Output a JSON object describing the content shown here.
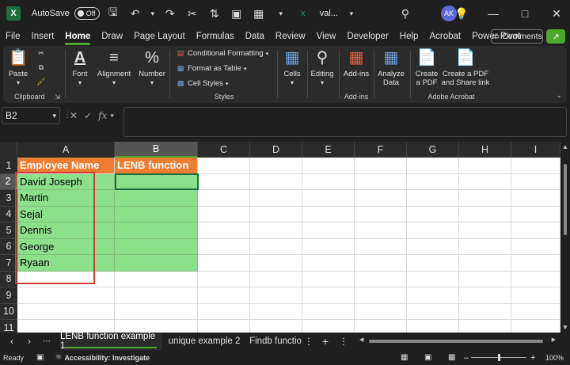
{
  "titlebar": {
    "app_icon": "X",
    "autosave_label": "AutoSave",
    "autosave_state": "Off",
    "filename": "val...",
    "avatar_initials": "AK"
  },
  "ribbon_tabs": [
    "File",
    "Insert",
    "Home",
    "Draw",
    "Page Layout",
    "Formulas",
    "Data",
    "Review",
    "View",
    "Developer",
    "Help",
    "Acrobat",
    "Power Pivot"
  ],
  "active_tab": "Home",
  "comments_label": "Comments",
  "ribbon": {
    "clipboard": {
      "paste": "Paste",
      "group": "Clipboard"
    },
    "font": {
      "label": "Font"
    },
    "alignment": {
      "label": "Alignment"
    },
    "number": {
      "label": "Number"
    },
    "styles": {
      "conditional": "Conditional Formatting",
      "format_table": "Format as Table",
      "cell_styles": "Cell Styles",
      "group": "Styles"
    },
    "cells": {
      "label": "Cells"
    },
    "editing": {
      "label": "Editing"
    },
    "addins": {
      "label": "Add-ins",
      "group": "Add-ins"
    },
    "analyze": {
      "line1": "Analyze",
      "line2": "Data"
    },
    "acrobat": {
      "create_pdf_1": "Create",
      "create_pdf_2": "a PDF",
      "share_1": "Create a PDF",
      "share_2": "and Share link",
      "group": "Adobe Acrobat"
    }
  },
  "formula_bar": {
    "name_box": "B2",
    "fx": "fx",
    "formula": ""
  },
  "columns": [
    "A",
    "B",
    "C",
    "D",
    "E",
    "F",
    "G",
    "H",
    "I"
  ],
  "rows": [
    "1",
    "2",
    "3",
    "4",
    "5",
    "6",
    "7",
    "8",
    "9",
    "10",
    "11"
  ],
  "sheet": {
    "header_a": "Employee Name",
    "header_b": "LENB function",
    "names": [
      "David Joseph",
      "Martin",
      "Sejal",
      "Dennis",
      "George",
      "Ryaan"
    ]
  },
  "sheet_tabs": [
    "LENB function example 1",
    "unique example 2",
    "Findb functio"
  ],
  "status": {
    "ready": "Ready",
    "accessibility": "Accessibility: Investigate",
    "zoom": "100%"
  },
  "colors": {
    "header_orange": "#ed7d31",
    "cell_green": "#8ce08c",
    "selection": "#1d6f42",
    "highlight_red": "#d03a3a"
  }
}
